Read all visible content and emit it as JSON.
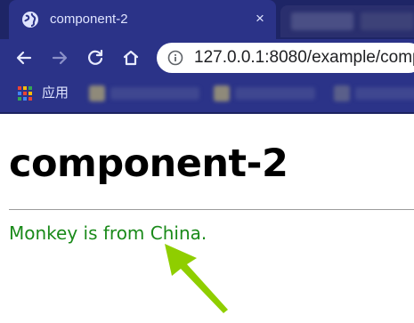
{
  "browser": {
    "tab": {
      "title": "component-2",
      "close_glyph": "×",
      "icon": "globe-icon"
    },
    "address_bar": {
      "url": "127.0.0.1:8080/example/comp",
      "icon": "info-icon"
    },
    "bookmarks_bar": {
      "apps_label": "应用",
      "icon": "apps-grid-icon"
    },
    "nav": {
      "back": "back-arrow-icon",
      "forward": "forward-arrow-icon",
      "reload": "reload-icon",
      "home": "home-icon"
    },
    "colors": {
      "chrome_dark": "#1e2566",
      "chrome": "#2b3388"
    }
  },
  "page": {
    "heading": "component-2",
    "message": "Monkey is from China.",
    "message_color": "#1a8a1a",
    "annotation_arrow_color": "#8fce00"
  }
}
